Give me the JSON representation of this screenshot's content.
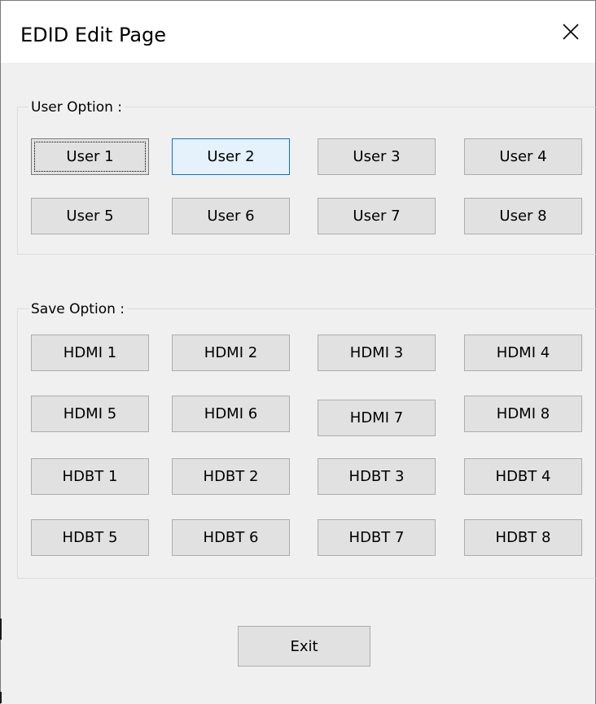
{
  "window": {
    "title": "EDID Edit Page",
    "close_icon": "close-icon"
  },
  "user_option": {
    "label": "User Option :",
    "buttons": [
      "User 1",
      "User 2",
      "User 3",
      "User 4",
      "User 5",
      "User 6",
      "User 7",
      "User 8"
    ],
    "focused": "User 1",
    "hovered": "User 2"
  },
  "save_option": {
    "label": "Save Option :",
    "buttons": [
      "HDMI 1",
      "HDMI 2",
      "HDMI 3",
      "HDMI 4",
      "HDMI 5",
      "HDMI 6",
      "HDMI 7",
      "HDMI 8",
      "HDBT 1",
      "HDBT 2",
      "HDBT 3",
      "HDBT 4",
      "HDBT 5",
      "HDBT 6",
      "HDBT 7",
      "HDBT 8"
    ]
  },
  "footer": {
    "exit_label": "Exit"
  },
  "colors": {
    "hover_border": "#0078d7",
    "hover_bg": "#e5f1fb",
    "button_bg": "#e1e1e1"
  }
}
